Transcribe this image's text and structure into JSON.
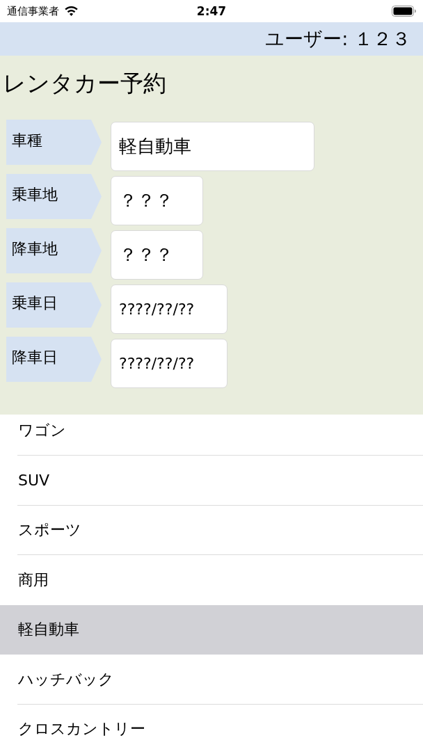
{
  "status_bar": {
    "carrier": "通信事業者",
    "time": "2:47"
  },
  "header": {
    "user": "ユーザー: １２３"
  },
  "title": "レンタカー予約",
  "form": [
    {
      "label": "車種",
      "kind": "select",
      "value": "軽自動車"
    },
    {
      "label": "乗車地",
      "kind": "place",
      "value": "？？？"
    },
    {
      "label": "降車地",
      "kind": "place",
      "value": "？？？"
    },
    {
      "label": "乗車日",
      "kind": "date",
      "value": "????/??/??"
    },
    {
      "label": "降車日",
      "kind": "date",
      "value": "????/??/??"
    }
  ],
  "picker": {
    "items": [
      {
        "label": "ワゴン",
        "selected": false
      },
      {
        "label": "SUV",
        "selected": false
      },
      {
        "label": "スポーツ",
        "selected": false
      },
      {
        "label": "商用",
        "selected": false
      },
      {
        "label": "軽自動車",
        "selected": true
      },
      {
        "label": "ハッチバック",
        "selected": false
      },
      {
        "label": "クロスカントリー",
        "selected": false
      }
    ]
  }
}
